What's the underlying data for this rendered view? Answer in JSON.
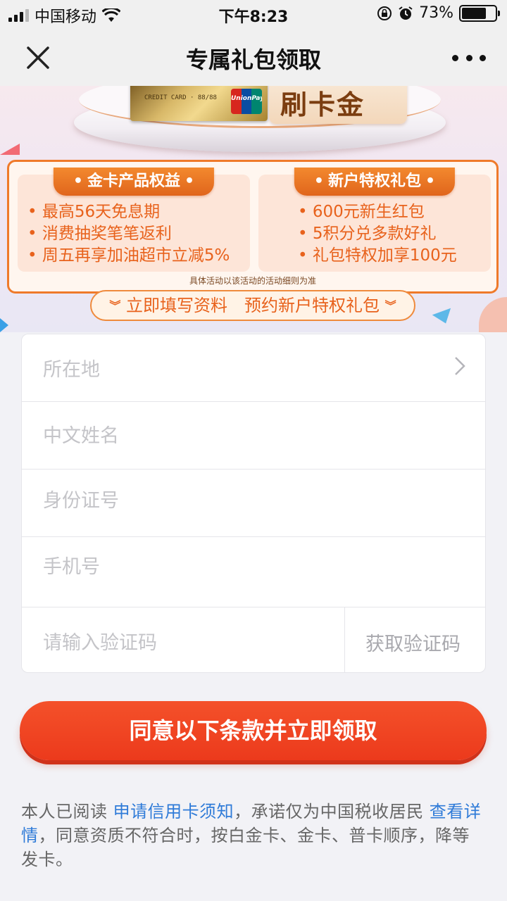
{
  "status_bar": {
    "carrier": "中国移动",
    "time": "下午8:23",
    "battery_percent": "73%",
    "battery_level": 0.73,
    "signal_bars_active": 3,
    "signal_bars_total": 4
  },
  "nav": {
    "title": "专属礼包领取"
  },
  "banner": {
    "card_tag": "刷卡金",
    "card_brand": "UnionPay",
    "panel_gold": {
      "title": "金卡产品权益",
      "items": [
        "最高56天免息期",
        "消费抽奖笔笔返利",
        "周五再享加油超市立减5%"
      ]
    },
    "panel_new": {
      "title": "新户特权礼包",
      "items": [
        "600元新生红包",
        "5积分兑多款好礼",
        "礼包特权加享100元"
      ]
    },
    "fine_print": "具体活动以该活动的活动细则为准",
    "cta_ribbon": "立即填写资料　预约新户特权礼包"
  },
  "form": {
    "location_placeholder": "所在地",
    "name_placeholder": "中文姓名",
    "id_placeholder": "身份证号",
    "phone_placeholder": "手机号",
    "code_placeholder": "请输入验证码",
    "get_code_label": "获取验证码"
  },
  "submit_label": "同意以下条款并立即领取",
  "agreement": {
    "prefix": "本人已阅读 ",
    "link_notice": "申请信用卡须知",
    "middle": "，承诺仅为中国税收居民 ",
    "link_details": "查看详情",
    "suffix": "，同意资质不符合时，按白金卡、金卡、普卡顺序，降等发卡。"
  },
  "colors": {
    "accent_orange": "#e8621c",
    "submit_red": "#ef4022",
    "link_blue": "#2f7bd8"
  }
}
